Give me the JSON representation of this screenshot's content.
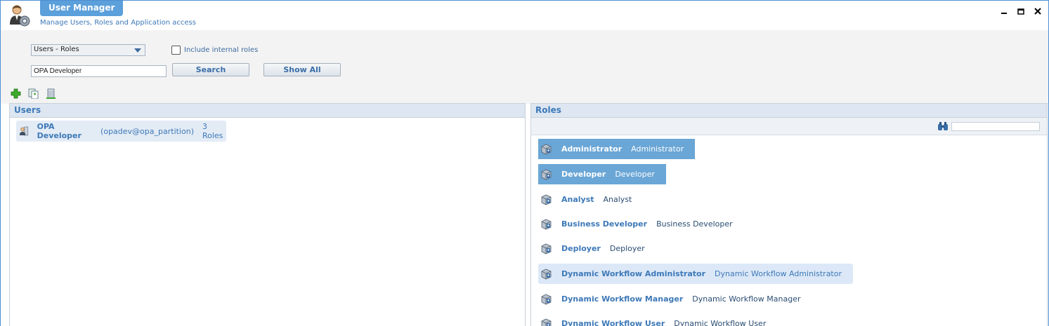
{
  "window": {
    "title": "User Manager",
    "subtitle": "Manage Users, Roles and Application access",
    "controls": {
      "minimize": "–",
      "maximize": "▭",
      "close": "✕"
    }
  },
  "filters": {
    "view_select": "Users - Roles",
    "include_internal_label": "Include internal roles",
    "search_value": "OPA Developer",
    "search_button": "Search",
    "show_all_button": "Show All"
  },
  "toolbar": {
    "icons": [
      "add-icon",
      "copy-icon",
      "building-icon"
    ]
  },
  "users_panel": {
    "title": "Users",
    "items": [
      {
        "name": "OPA Developer",
        "id": "(opadev@opa_partition)",
        "roles": "3 Roles"
      }
    ]
  },
  "roles_panel": {
    "title": "Roles",
    "items": [
      {
        "name": "Administrator",
        "desc": "Administrator",
        "state": "selected"
      },
      {
        "name": "Developer",
        "desc": "Developer",
        "state": "selected"
      },
      {
        "name": "Analyst",
        "desc": "Analyst",
        "state": "normal"
      },
      {
        "name": "Business Developer",
        "desc": "Business Developer",
        "state": "normal"
      },
      {
        "name": "Deployer",
        "desc": "Deployer",
        "state": "normal"
      },
      {
        "name": "Dynamic Workflow Administrator",
        "desc": "Dynamic Workflow Administrator",
        "state": "hover"
      },
      {
        "name": "Dynamic Workflow Manager",
        "desc": "Dynamic Workflow Manager",
        "state": "normal"
      },
      {
        "name": "Dynamic Workflow User",
        "desc": "Dynamic Workflow User",
        "state": "normal"
      }
    ]
  },
  "colors": {
    "accent": "#5b9fdb",
    "selected_row": "#6aa6d6",
    "hover_row": "#dce8f7",
    "link_text": "#3d79b8"
  }
}
